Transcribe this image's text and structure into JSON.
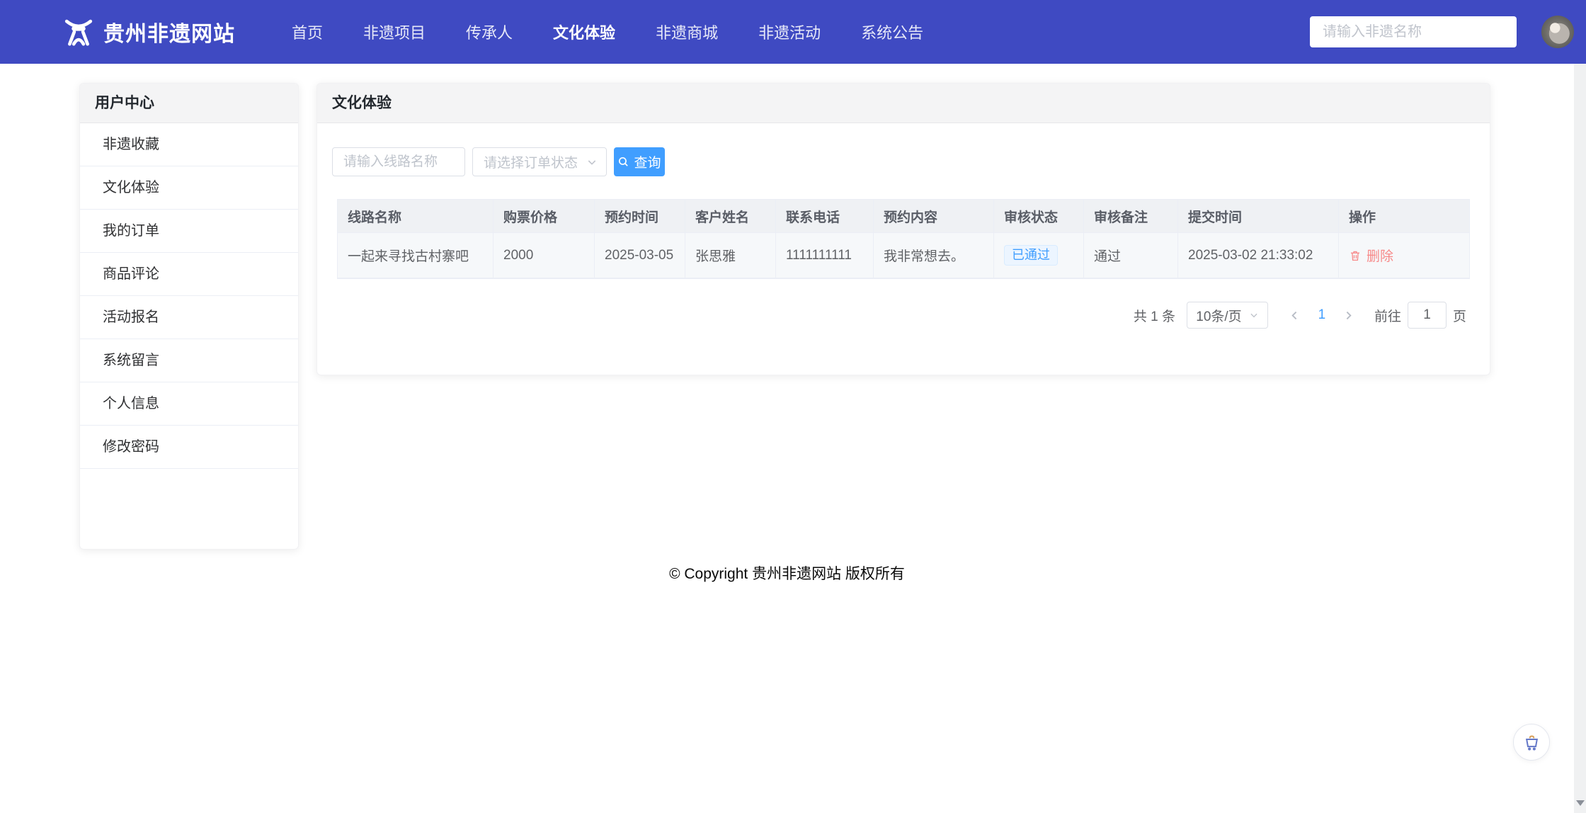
{
  "navbar": {
    "brand": "贵州非遗网站",
    "items": [
      "首页",
      "非遗项目",
      "传承人",
      "文化体验",
      "非遗商城",
      "非遗活动",
      "系统公告"
    ],
    "active_item": "文化体验",
    "search_placeholder": "请输入非遗名称"
  },
  "sidebar": {
    "title": "用户中心",
    "items": [
      "非遗收藏",
      "文化体验",
      "我的订单",
      "商品评论",
      "活动报名",
      "系统留言",
      "个人信息",
      "修改密码"
    ]
  },
  "main": {
    "title": "文化体验",
    "filters": {
      "name_placeholder": "请输入线路名称",
      "status_placeholder": "请选择订单状态",
      "search_button": "查询"
    },
    "table": {
      "columns": [
        "线路名称",
        "购票价格",
        "预约时间",
        "客户姓名",
        "联系电话",
        "预约内容",
        "审核状态",
        "审核备注",
        "提交时间",
        "操作"
      ],
      "rows": [
        {
          "route": "一起来寻找古村寨吧",
          "price": "2000",
          "book_date": "2025-03-05",
          "customer": "张思雅",
          "phone": "1111111111",
          "content": "我非常想去。",
          "status": "已通过",
          "remark": "通过",
          "submitted": "2025-03-02 21:33:02",
          "action": "删除"
        }
      ]
    },
    "pagination": {
      "total": "共 1 条",
      "page_size": "10条/页",
      "current_page": "1",
      "goto_label": "前往",
      "goto_value": "1",
      "page_unit": "页"
    }
  },
  "footer": {
    "copyright": "© Copyright 贵州非遗网站 版权所有"
  },
  "colors": {
    "navbar": "#3f4ac2",
    "primary": "#409eff",
    "danger": "#f78989",
    "status_tag_bg": "#ecf5ff",
    "status_tag_border": "#d9ecff"
  }
}
